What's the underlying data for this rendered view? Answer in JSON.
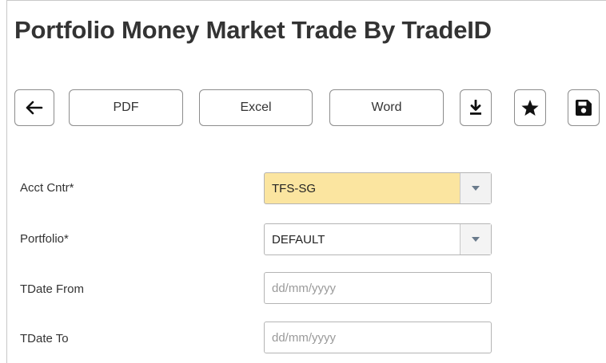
{
  "page": {
    "title": "Portfolio Money Market Trade By TradeID"
  },
  "toolbar": {
    "back_icon": "arrow-left-icon",
    "pdf_label": "PDF",
    "excel_label": "Excel",
    "word_label": "Word",
    "download_icon": "download-icon",
    "favorite_icon": "star-icon",
    "save_icon": "floppy-disk-icon"
  },
  "form": {
    "acct_cntr": {
      "label": "Acct Cntr*",
      "value": "TFS-SG",
      "highlight_color": "#fbe5a0"
    },
    "portfolio": {
      "label": "Portfolio*",
      "value": "DEFAULT"
    },
    "tdate_from": {
      "label": "TDate From",
      "value": "",
      "placeholder": "dd/mm/yyyy"
    },
    "tdate_to": {
      "label": "TDate To",
      "value": "",
      "placeholder": "dd/mm/yyyy"
    }
  }
}
